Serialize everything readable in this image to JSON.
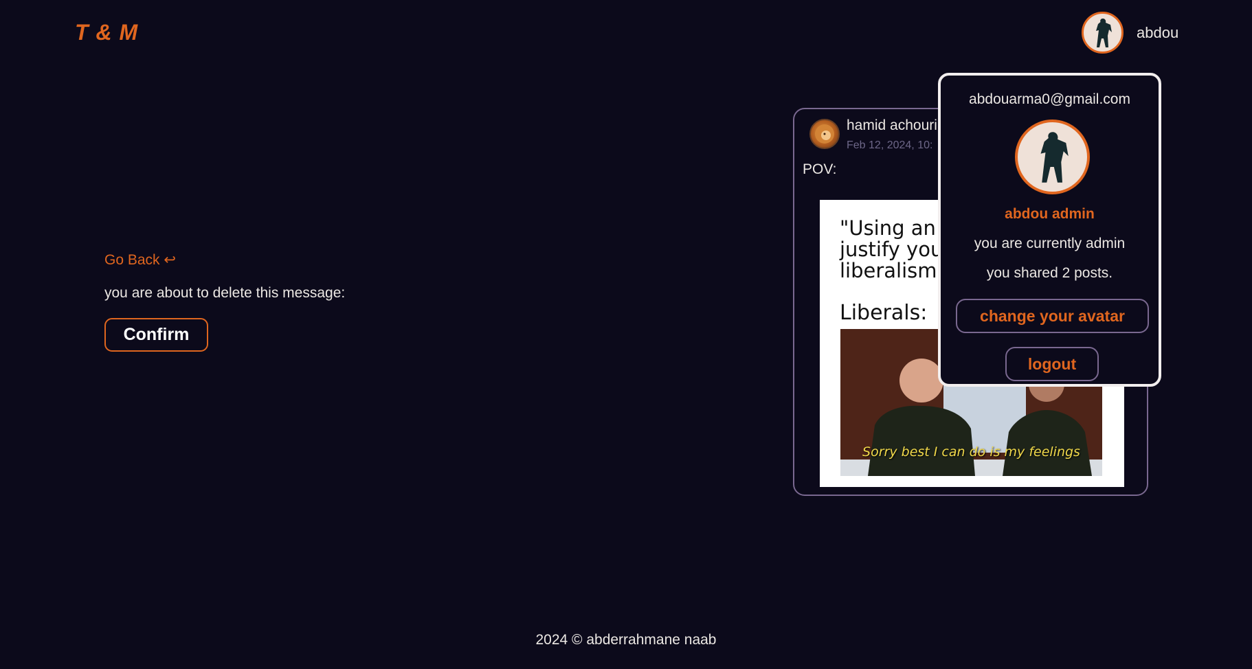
{
  "header": {
    "logo": "T & M",
    "username": "abdou"
  },
  "delete_view": {
    "go_back": "Go Back ↩",
    "prompt": "you are about to delete this message:",
    "confirm": "Confirm"
  },
  "post": {
    "author": "hamid achouri",
    "date": "Feb 12, 2024, 10:",
    "text": "POV:",
    "meme": {
      "quote": "\"Using an\njustify you\nliberalism",
      "liberals": "Liberals:",
      "caption": "Sorry best I can do is my feelings"
    }
  },
  "profile_menu": {
    "email": "abdouarma0@gmail.com",
    "display_name": "abdou admin",
    "role_text": "you are currently admin",
    "posts_text": "you shared 2 posts.",
    "change_avatar": "change your avatar",
    "logout": "logout"
  },
  "footer": {
    "text": "2024 © abderrahmane naab"
  },
  "colors": {
    "background": "#0c0a1b",
    "accent": "#e0661f",
    "border_muted": "#7a6890",
    "text": "#ece8e4"
  },
  "icons": {
    "avatar": "warrior-silhouette-icon",
    "post_avatar": "lion-icon"
  }
}
